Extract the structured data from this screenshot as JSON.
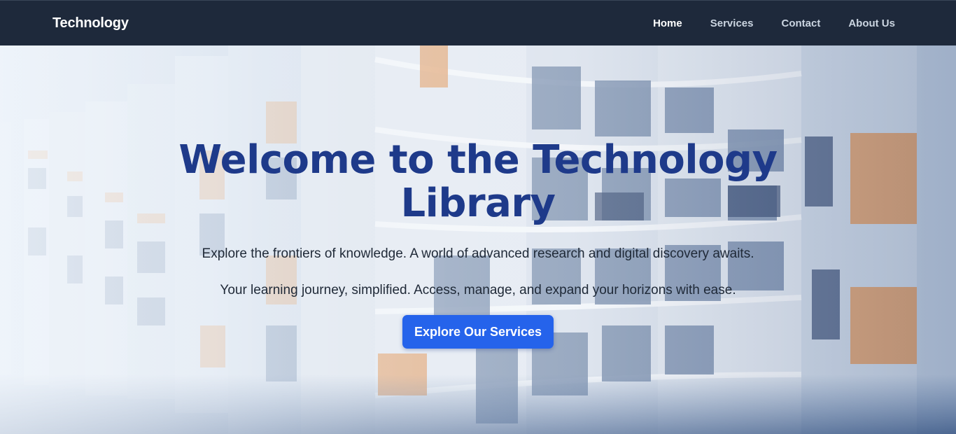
{
  "navbar": {
    "brand": "Technology",
    "links": [
      {
        "label": "Home",
        "active": true
      },
      {
        "label": "Services",
        "active": false
      },
      {
        "label": "Contact",
        "active": false
      },
      {
        "label": "About Us",
        "active": false
      }
    ]
  },
  "hero": {
    "title": "Welcome to the Technology Library",
    "subtitle_1": "Explore the frontiers of knowledge. A world of advanced research and digital discovery awaits.",
    "subtitle_2": "Your learning journey, simplified. Access, manage, and expand your horizons with ease.",
    "cta_label": "Explore Our Services",
    "background_image": "library-bookshelves-photo"
  },
  "colors": {
    "navbar_bg": "#1e293b",
    "title": "#1e3a8a",
    "cta_bg": "#2563eb",
    "text": "#1f2937"
  }
}
